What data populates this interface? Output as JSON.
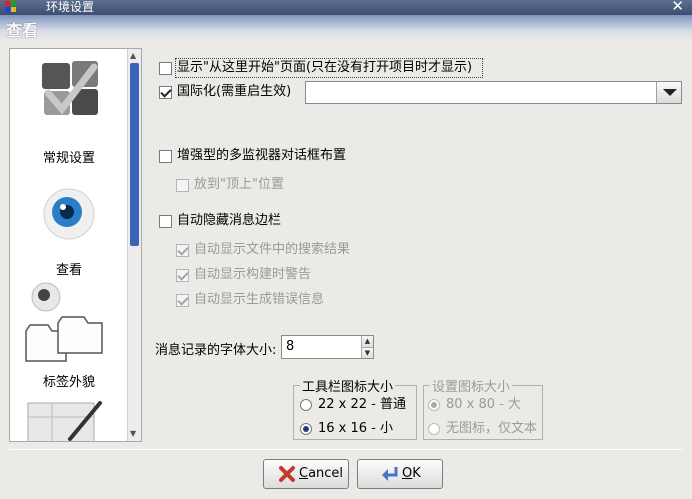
{
  "window": {
    "title": "环境设置",
    "close_glyph": "✕"
  },
  "header": {
    "title": "查看"
  },
  "sidebar": {
    "items": [
      {
        "label": "常规设置",
        "icon": "general-settings-icon"
      },
      {
        "label": "查看",
        "icon": "eye-icon"
      },
      {
        "label": "标签外貌",
        "icon": "tabs-icon"
      },
      {
        "label": "",
        "icon": "brush-icon"
      }
    ]
  },
  "options": {
    "show_start_page": {
      "label": "显示\"从这里开始\"页面(只在没有打开项目时才显示)",
      "checked": false
    },
    "i18n": {
      "label": "国际化(需重启生效)",
      "checked": true,
      "combo_value": ""
    },
    "multi_monitor": {
      "label": "增强型的多监视器对话框布置",
      "checked": false
    },
    "place_on_top": {
      "label": "放到\"顶上\"位置",
      "checked": false,
      "enabled": false
    },
    "autohide_msg": {
      "label": "自动隐藏消息边栏",
      "checked": false
    },
    "show_search": {
      "label": "自动显示文件中的搜索结果",
      "checked": true,
      "enabled": false
    },
    "show_build_warn": {
      "label": "自动显示构建时警告",
      "checked": true,
      "enabled": false
    },
    "show_build_err": {
      "label": "自动显示生成错误信息",
      "checked": true,
      "enabled": false
    }
  },
  "font_size": {
    "label": "消息记录的字体大小:",
    "value": "8"
  },
  "toolbar_icon_size": {
    "legend": "工具栏图标大小",
    "options": [
      {
        "label": "22 x 22 - 普通",
        "selected": false
      },
      {
        "label": "16 x 16 - 小",
        "selected": true
      }
    ]
  },
  "settings_icon_size": {
    "legend": "设置图标大小",
    "options": [
      {
        "label": "80 x 80 - 大",
        "selected": true
      },
      {
        "label": "无图标，仅文本",
        "selected": false
      }
    ]
  },
  "buttons": {
    "cancel": {
      "label_prefix": "",
      "mnemonic": "C",
      "label_rest": "ancel"
    },
    "ok": {
      "label_prefix": "",
      "mnemonic": "O",
      "label_rest": "K"
    }
  },
  "colors": {
    "accent": "#3b63b4",
    "title_bar": "#4a5c7d",
    "cancel_icon": "#c23a2a",
    "ok_icon": "#4a72c8"
  }
}
